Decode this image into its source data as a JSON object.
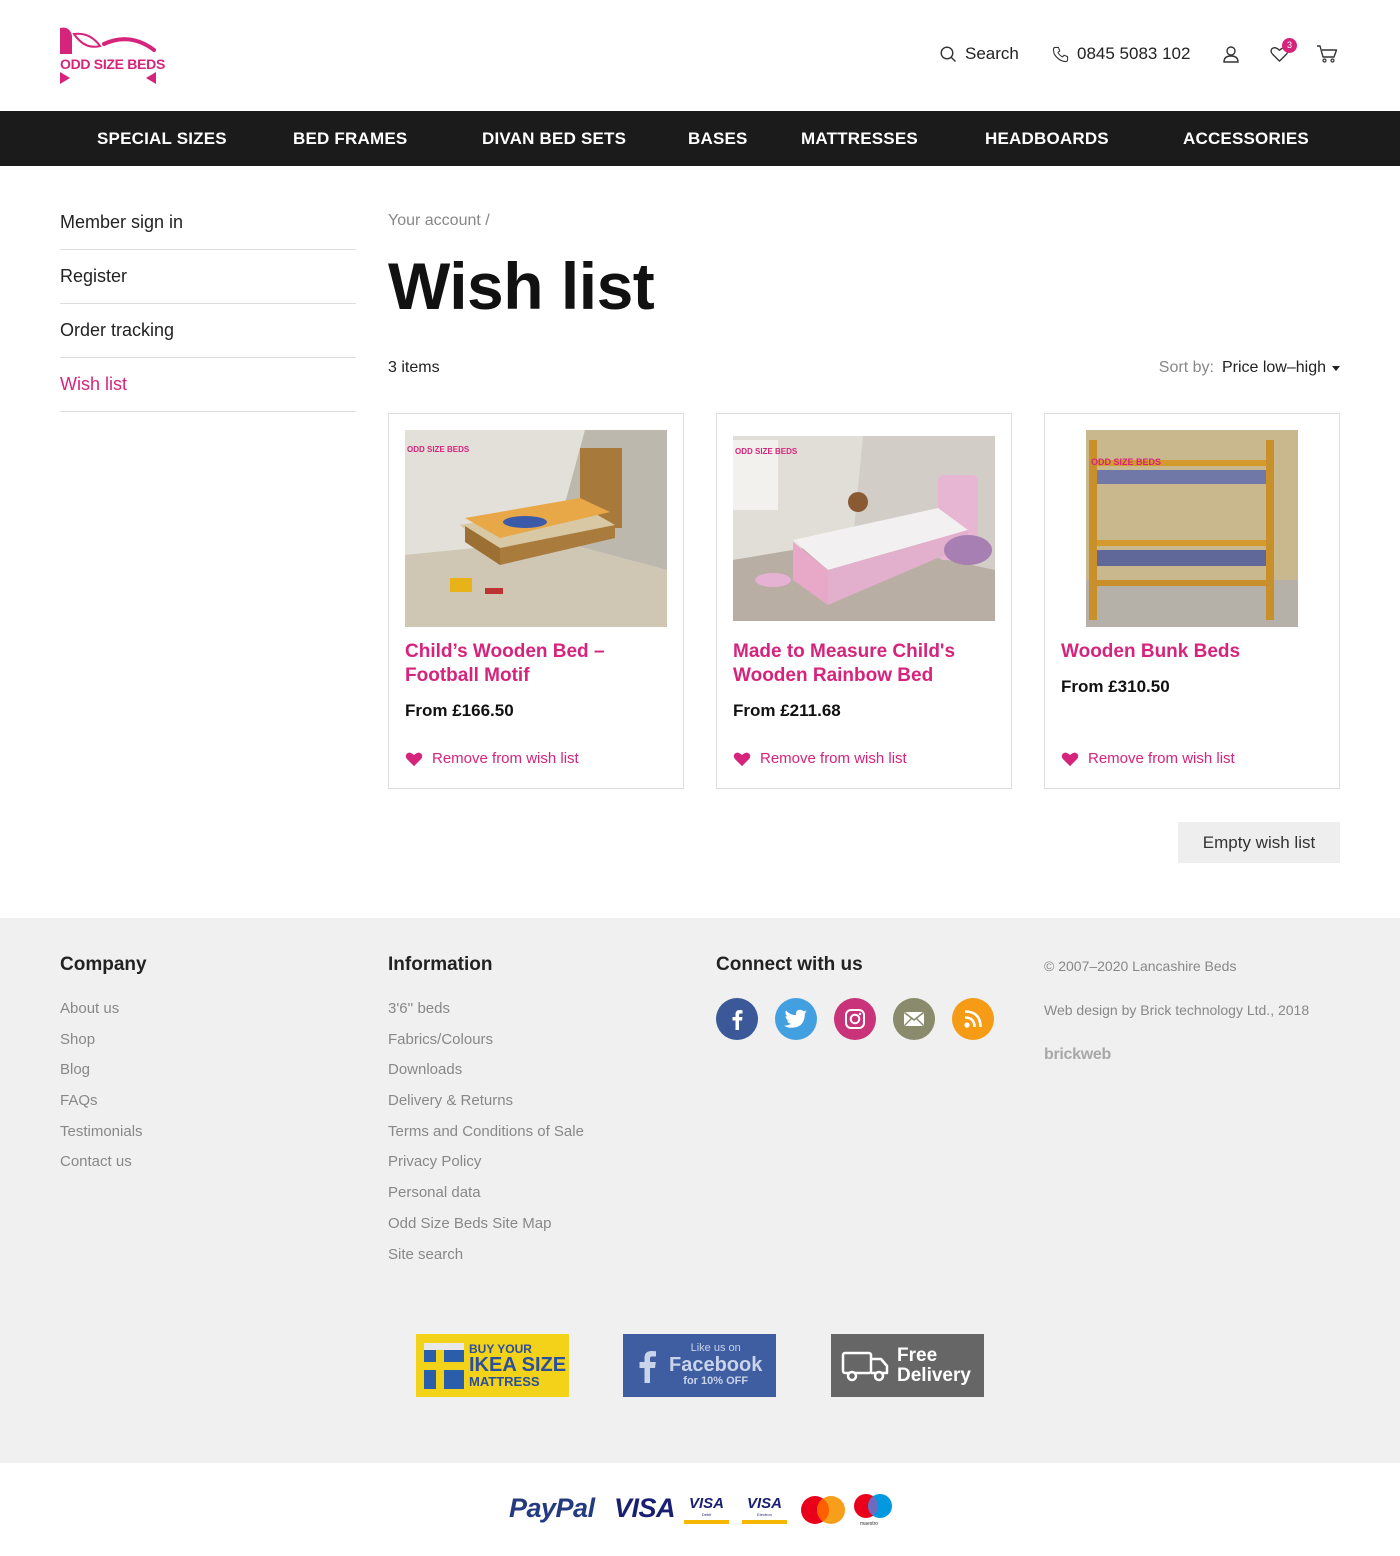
{
  "brand": {
    "logo_text": "ODD SIZE BEDS",
    "accent": "#d6247c"
  },
  "header": {
    "search_label": "Search",
    "phone": "0845 5083 102",
    "wishlist_count": "3"
  },
  "nav": [
    "SPECIAL SIZES",
    "BED FRAMES",
    "DIVAN BED SETS",
    "BASES",
    "MATTRESSES",
    "HEADBOARDS",
    "ACCESSORIES"
  ],
  "sidebar": [
    {
      "label": "Member sign in"
    },
    {
      "label": "Register"
    },
    {
      "label": "Order tracking"
    },
    {
      "label": "Wish list",
      "active": true
    }
  ],
  "breadcrumb": "Your account  /",
  "page_title": "Wish list",
  "item_count": "3 items",
  "sort": {
    "label": "Sort by:",
    "value": "Price low–high"
  },
  "products": [
    {
      "title": "Child’s Wooden Bed – Football Motif",
      "price": "From £166.50",
      "remove": "Remove from wish list"
    },
    {
      "title": "Made to Measure Child's Wooden Rainbow Bed",
      "price": "From £211.68",
      "remove": "Remove from wish list"
    },
    {
      "title": "Wooden Bunk Beds",
      "price": "From £310.50",
      "remove": "Remove from wish list"
    }
  ],
  "empty_button": "Empty wish list",
  "footer": {
    "company": {
      "heading": "Company",
      "links": [
        "About us",
        "Shop",
        "Blog",
        "FAQs",
        "Testimonials",
        "Contact us"
      ]
    },
    "information": {
      "heading": "Information",
      "links": [
        "3'6'' beds",
        "Fabrics/Colours",
        "Downloads",
        "Delivery & Returns",
        "Terms and Conditions of Sale",
        "Privacy Policy",
        "Personal data",
        "Odd Size Beds Site Map",
        "Site search"
      ]
    },
    "connect": {
      "heading": "Connect with us",
      "icons": [
        "facebook-icon",
        "twitter-icon",
        "instagram-icon",
        "email-icon",
        "rss-icon"
      ]
    },
    "copyright": "© 2007–2020  Lancashire Beds",
    "webdesign": "Web design by Brick technology Ltd., 2018",
    "brickweb": "brickweb",
    "banners": {
      "ikea": {
        "line1": "BUY YOUR",
        "line2": "IKEA SIZE",
        "line3": "MATTRESS"
      },
      "facebook": {
        "line1": "Like us on",
        "line2": "Facebook",
        "line3": "for 10% OFF"
      },
      "delivery": {
        "line1": "Free",
        "line2": "Delivery"
      }
    }
  },
  "payments": {
    "paypal": "PayPal",
    "visa": "VISA",
    "visa_debit": "VISA",
    "visa_debit_sub": "Debit",
    "visa_electron": "VISA",
    "visa_electron_sub": "Electron",
    "maestro": "maestro"
  }
}
